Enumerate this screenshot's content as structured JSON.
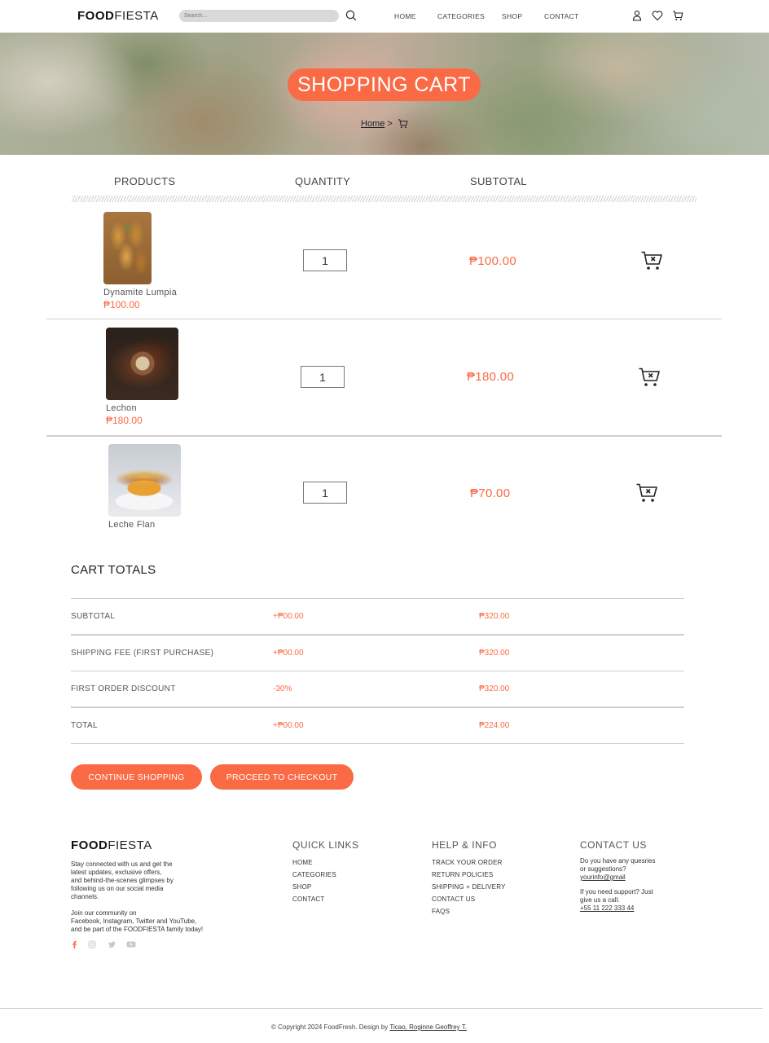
{
  "nav": {
    "brand_bold": "FOOD",
    "brand_light": "FIESTA",
    "search_placeholder": "Search...",
    "links": [
      "HOME",
      "CATEGORIES",
      "SHOP",
      "CONTACT"
    ]
  },
  "hero": {
    "title": "SHOPPING CART",
    "breadcrumb_home": "Home",
    "breadcrumb_sep": ">"
  },
  "table": {
    "headers": [
      "PRODUCTS",
      "QUANTITY",
      "SUBTOTAL"
    ],
    "items": [
      {
        "name": "Dynamite Lumpia",
        "price": "₱100.00",
        "quantity": "1",
        "subtotal": "₱100.00"
      },
      {
        "name": "Lechon",
        "price": "₱180.00",
        "quantity": "1",
        "subtotal": "₱180.00"
      },
      {
        "name": "Leche Flan",
        "price": "",
        "quantity": "1",
        "subtotal": "₱70.00"
      }
    ]
  },
  "totals": {
    "title": "CART TOTALS",
    "rows": [
      {
        "label": "SUBTOTAL",
        "mid": "+₱00.00",
        "value": "₱320.00"
      },
      {
        "label": "SHIPPING FEE (FIRST PURCHASE)",
        "mid": "+₱00.00",
        "value": "₱320.00"
      },
      {
        "label": "FIRST ORDER DISCOUNT",
        "mid": "-30%",
        "value": "₱320.00"
      },
      {
        "label": "TOTAL",
        "mid": "+₱00.00",
        "value": "₱224.00"
      }
    ]
  },
  "buttons": {
    "continue": "CONTINUE SHOPPING",
    "checkout": "PROCEED TO CHECKOUT"
  },
  "footer": {
    "brand_bold": "FOOD",
    "brand_light": "FIESTA",
    "about": [
      "Stay connected with us and get the",
      "latest updates, exclusive offers,",
      "and behind-the-scenes glimpses by",
      "following us on our social media",
      "channels."
    ],
    "community": [
      "Join our community on",
      "Facebook, Instagram, Twitter and YouTube,",
      "and be part of the FOODFIESTA family today!"
    ],
    "quick_links_title": "QUICK LINKS",
    "quick_links": [
      "HOME",
      "CATEGORIES",
      "SHOP",
      "CONTACT"
    ],
    "help_title": "HELP & INFO",
    "help_links": [
      "TRACK YOUR ORDER",
      "RETURN POLICIES",
      "SHIPPING + DELIVERY",
      "CONTACT US",
      "FAQS"
    ],
    "contact_title": "CONTACT US",
    "contact_q1": "Do you have any quesries",
    "contact_q2": "or suggestions?",
    "contact_email": "yourinfo@gmail",
    "contact_s1": "If you need support? Just",
    "contact_s2": "give us a call.",
    "contact_phone": "+55 11 222 333 44",
    "copyright": "© Copyright 2024 FoodFresh. Design by ",
    "designer": "Ticao, Roginne Geoffrey T."
  },
  "colors": {
    "accent": "#fa6a44",
    "search_bg": "#d9d9d9"
  },
  "icons": [
    "search-icon",
    "user-icon",
    "heart-icon",
    "cart-icon",
    "remove-from-cart-icon",
    "facebook-icon",
    "instagram-icon",
    "twitter-icon",
    "youtube-icon"
  ]
}
